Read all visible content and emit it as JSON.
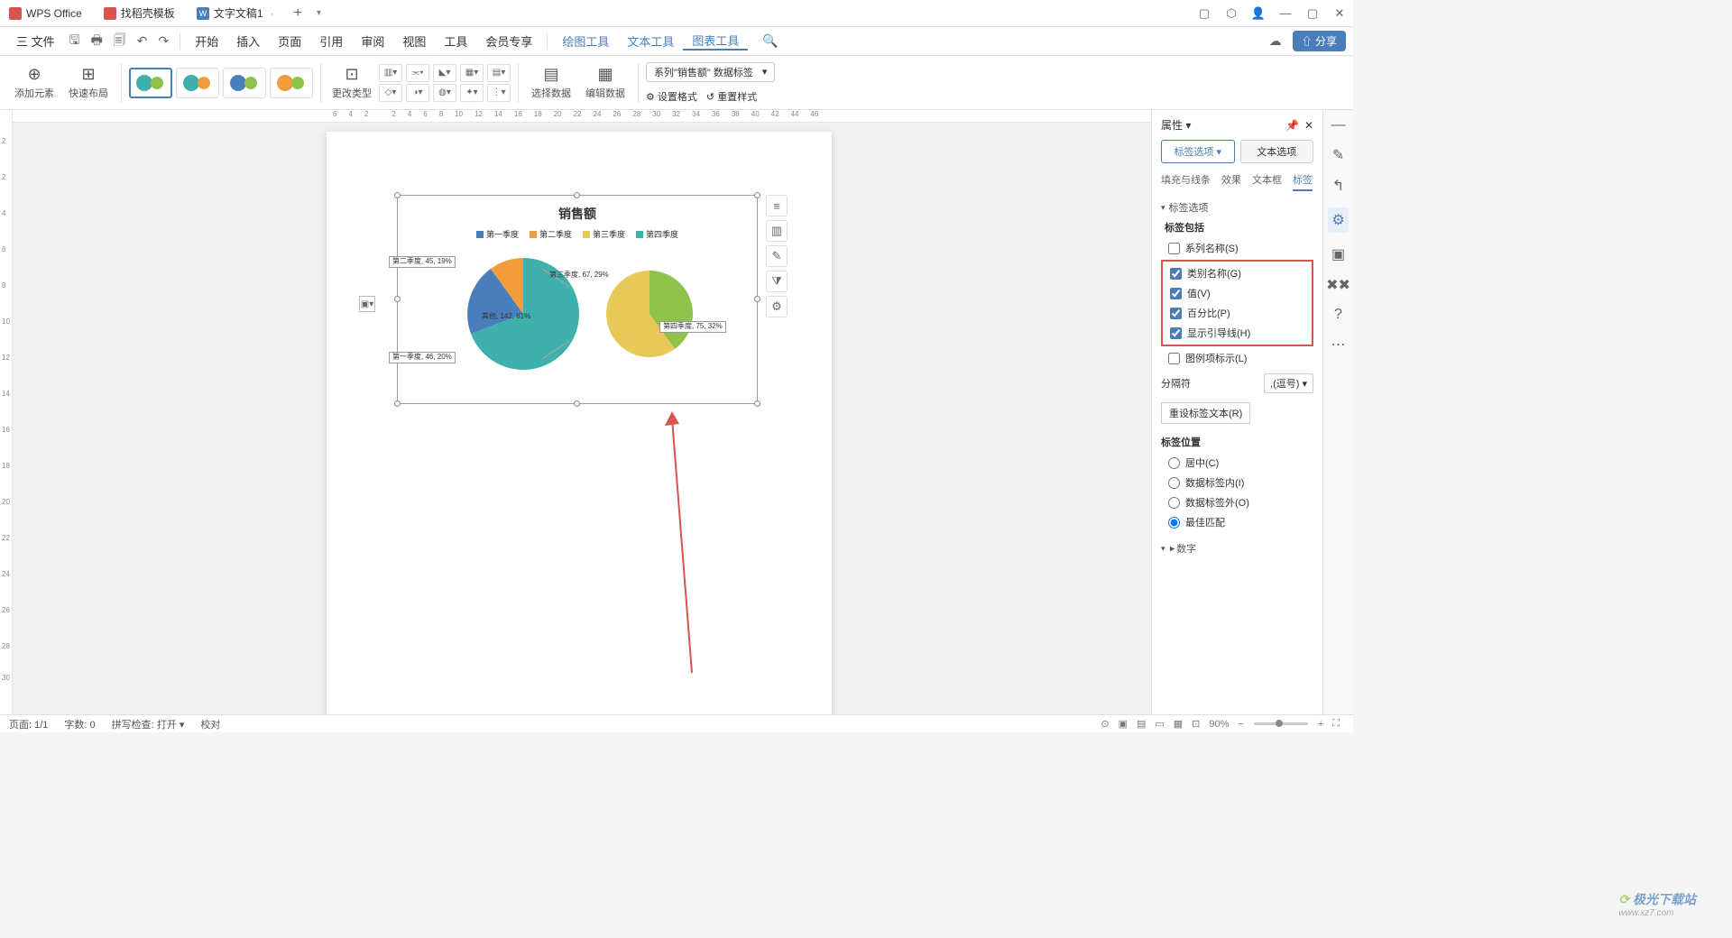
{
  "titlebar": {
    "tabs": [
      {
        "label": "WPS Office",
        "icon": "red"
      },
      {
        "label": "找稻壳模板",
        "icon": "red"
      },
      {
        "label": "文字文稿1",
        "icon": "blue",
        "active": true
      }
    ]
  },
  "menubar": {
    "file": "三 文件",
    "items": [
      "开始",
      "插入",
      "页面",
      "引用",
      "审阅",
      "视图",
      "工具",
      "会员专享"
    ],
    "extra": [
      "绘图工具",
      "文本工具",
      "图表工具"
    ],
    "active_extra": "图表工具",
    "share": "分享"
  },
  "ribbon": {
    "add_element": "添加元素",
    "quick_layout": "快速布局",
    "change_type": "更改类型",
    "select_data": "选择数据",
    "edit_data": "编辑数据",
    "series_selector": "系列\"销售额\" 数据标签",
    "set_format": "设置格式",
    "reset_style": "重置样式"
  },
  "hruler": [
    "6",
    "4",
    "2",
    "",
    "2",
    "4",
    "6",
    "8",
    "10",
    "12",
    "14",
    "16",
    "18",
    "20",
    "22",
    "24",
    "26",
    "28",
    "30",
    "32",
    "34",
    "36",
    "38",
    "40",
    "42",
    "44",
    "46"
  ],
  "vruler": [
    "2",
    "2",
    "4",
    "6",
    "8",
    "10",
    "12",
    "14",
    "16",
    "18",
    "20",
    "22",
    "24",
    "26",
    "28",
    "30"
  ],
  "chart_data": {
    "type": "pie",
    "title": "销售额",
    "legend": [
      "第一季度",
      "第二季度",
      "第三季度",
      "第四季度"
    ],
    "colors": {
      "q1": "#4a7ebb",
      "q2": "#f39c3c",
      "q3": "#3fb0ac",
      "q4": "#8fc24a",
      "other": "#3fb0ac"
    },
    "main_pie": [
      {
        "name": "第一季度",
        "value": 46,
        "pct": "20%"
      },
      {
        "name": "第二季度",
        "value": 45,
        "pct": "19%"
      },
      {
        "name": "其他",
        "value": 142,
        "pct": "61%"
      }
    ],
    "sub_pie": [
      {
        "name": "第三季度",
        "value": 67,
        "pct": "29%"
      },
      {
        "name": "第四季度",
        "value": 75,
        "pct": "32%"
      }
    ],
    "labels": {
      "q1": "第一季度, 46, 20%",
      "q2": "第二季度, 45, 19%",
      "other": "其他, 142, 61%",
      "q3": "第三季度, 67, 29%",
      "q4": "第四季度, 75, 32%"
    }
  },
  "props": {
    "title": "属性",
    "tab1": "标签选项",
    "tab2": "文本选项",
    "subtabs": [
      "填充与线条",
      "效果",
      "文本框",
      "标签"
    ],
    "active_subtab": "标签",
    "section_label_options": "标签选项",
    "label_contains": "标签包括",
    "series_name": "系列名称(S)",
    "category_name": "类别名称(G)",
    "value": "值(V)",
    "percent": "百分比(P)",
    "leader_lines": "显示引导线(H)",
    "legend_key": "图例项标示(L)",
    "separator": "分隔符",
    "separator_val": ",(逗号)",
    "reset_text": "重设标签文本(R)",
    "label_position": "标签位置",
    "pos_center": "居中(C)",
    "pos_inside": "数据标签内(I)",
    "pos_outside": "数据标签外(O)",
    "pos_best": "最佳匹配",
    "section_number": "数字"
  },
  "statusbar": {
    "page": "页面: 1/1",
    "words": "字数: 0",
    "spell": "拼写检查: 打开",
    "proof": "校对",
    "zoom": "90%"
  },
  "watermark": {
    "line1": "极光下载站",
    "line2": "www.xz7.com"
  }
}
